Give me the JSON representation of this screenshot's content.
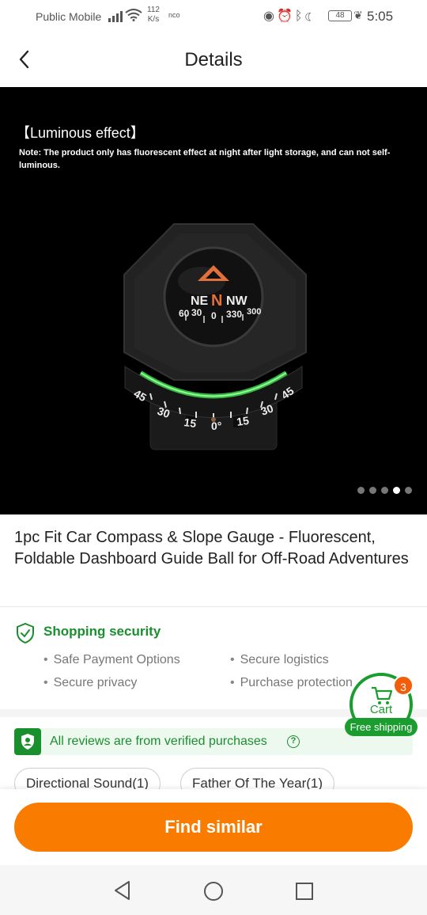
{
  "status_bar": {
    "carrier": "Public Mobile",
    "net_speed_value": "112",
    "net_speed_unit": "K/s",
    "nfc": "nco",
    "battery": "48",
    "time": "5:05"
  },
  "header": {
    "title": "Details"
  },
  "hero": {
    "luminous_title": "【Luminous effect】",
    "luminous_note": "Note: The product only has fluorescent effect at night after light storage, and can not self-luminous.",
    "dot_count": 5,
    "active_dot": 4
  },
  "product": {
    "title": "1pc Fit Car Compass & Slope Gauge - Fluorescent, Foldable Dashboard Guide Ball for Off-Road Adventures"
  },
  "security": {
    "title": "Shopping security",
    "items": [
      "Safe Payment Options",
      "Secure logistics",
      "Secure privacy",
      "Purchase protection"
    ]
  },
  "reviews": {
    "verified_text": "All reviews are from verified purchases",
    "tags": [
      "Directional Sound(1)",
      "Father Of The Year(1)"
    ]
  },
  "cart": {
    "label": "Cart",
    "count": "3",
    "free_shipping": "Free shipping"
  },
  "actions": {
    "find_similar": "Find similar"
  },
  "colors": {
    "accent_orange": "#f97c00",
    "green": "#1a8f2e",
    "badge_orange": "#f25d09"
  }
}
